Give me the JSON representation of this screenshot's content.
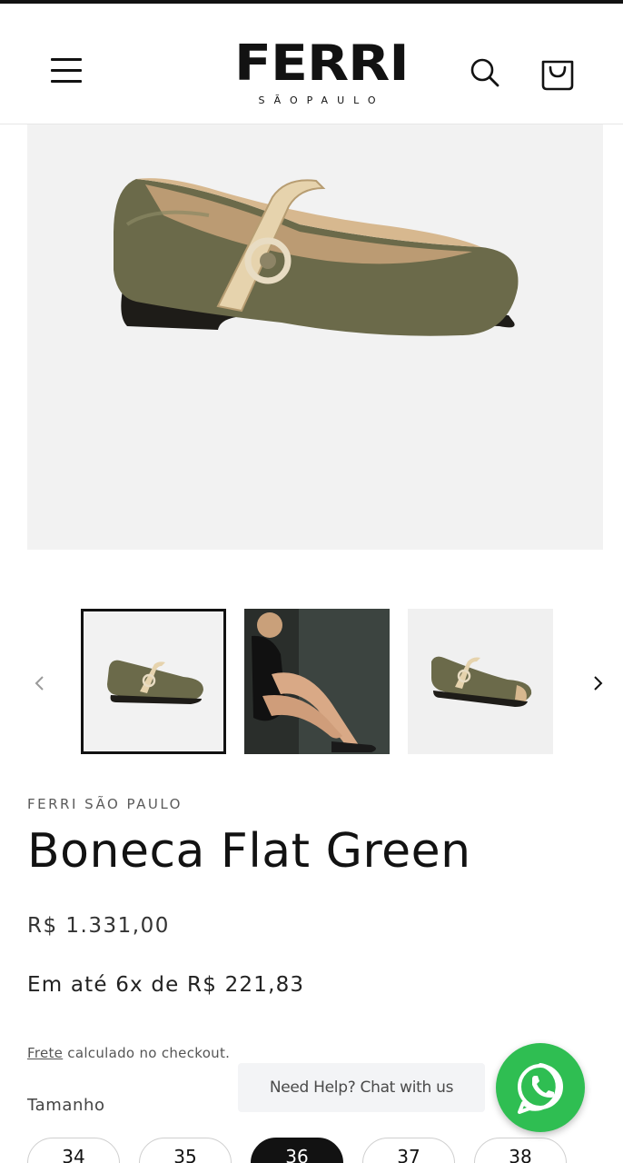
{
  "header": {
    "brand": "FERRI",
    "brand_sub": "SÃOPAULO",
    "icons": {
      "menu": "hamburger-menu-icon",
      "search": "search-icon",
      "cart": "shopping-bag-icon"
    }
  },
  "gallery": {
    "thumbnails": [
      {
        "name": "green-flat-side",
        "selected": true
      },
      {
        "name": "model-wearing-flat",
        "selected": false
      },
      {
        "name": "green-flat-angle",
        "selected": false
      }
    ],
    "prev_icon": "chevron-left-icon",
    "next_icon": "chevron-right-icon"
  },
  "product": {
    "vendor": "FERRI SÃO PAULO",
    "title": "Boneca Flat Green",
    "price": "R$ 1.331,00",
    "installment": "Em até 6x de R$ 221,83",
    "shipping_link": "Frete",
    "shipping_rest": " calculado no checkout.",
    "size_label": "Tamanho",
    "sizes": [
      "34",
      "35",
      "36",
      "37",
      "38"
    ],
    "selected_size": "36"
  },
  "chat": {
    "bubble_text": "Need Help? Chat with us",
    "button_icon": "whatsapp-icon",
    "color": "#2fbe52"
  },
  "colors": {
    "text": "#121212",
    "hero_bg": "#f2f2f2",
    "shoe": "#6b6a4a"
  }
}
